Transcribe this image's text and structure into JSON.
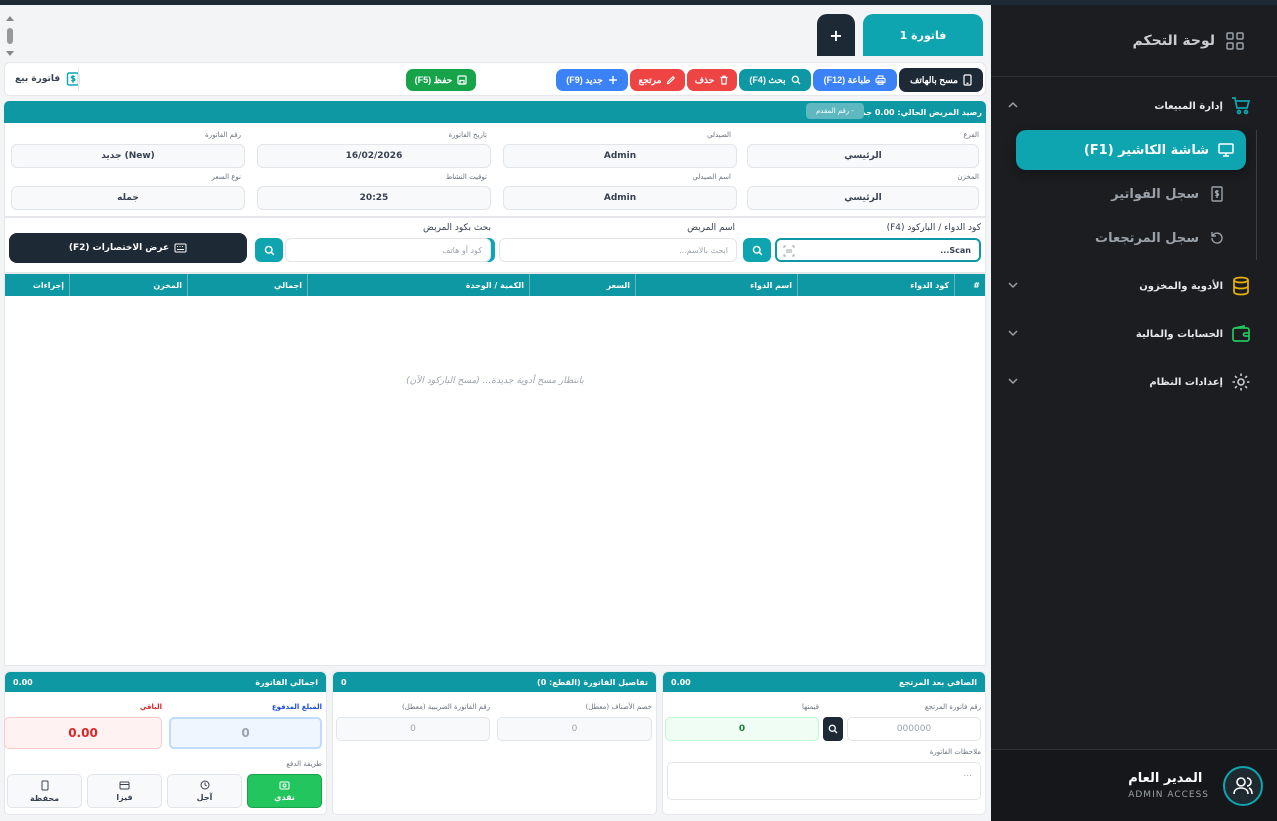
{
  "sidebar": {
    "dashboard": "لوحة التحكم",
    "sales_section": "إدارة المبيعات",
    "cashier": "شاشة الكاشير (F1)",
    "invoices_log": "سجل الفواتير",
    "returns_log": "سجل المرتجعات",
    "medicines_section": "الأدوية والمخزون",
    "accounts_section": "الحسابات والمالية",
    "settings_section": "إعدادات النظام",
    "user_name": "المدير العام",
    "user_role": "ADMIN ACCESS"
  },
  "tabs": {
    "invoice_tab": "فاتورة 1",
    "add": "+"
  },
  "toolbar": {
    "sale_invoice": "فاتورة بيع",
    "scan_mobile": "مسح بالهاتف",
    "print": "طباعة (F12)",
    "search": "بحث (F4)",
    "delete": "حذف",
    "return": "مرتجع",
    "new": "جديد (F9)",
    "save": "حفظ (F5)"
  },
  "balance": {
    "label": "رصيد المريض الحالي:",
    "value": "0.00 جم",
    "pill": "رقم المقدم -"
  },
  "info": {
    "branch_label": "الفرع",
    "branch": "الرئيسي",
    "pharmacist_label": "الصيدلي",
    "pharmacist": "Admin",
    "date_label": "تاريخ الفاتورة",
    "date": "16/02/2026",
    "invoice_no_label": "رقم الفاتورة",
    "invoice_no": "جديد (New)",
    "store_label": "المخزن",
    "store": "الرئيسي",
    "pharmacist_name_label": "اسم الصيدلي",
    "pharmacist_name": "Admin",
    "time_label": "توقيت النشاط",
    "time": "20:25",
    "price_type_label": "نوع السعر",
    "price_type": "جمله"
  },
  "search": {
    "barcode_label": "كود الدواء / الباركود (F4)",
    "barcode_placeholder": "Scan...",
    "patient_label": "اسم المريض",
    "patient_placeholder": "ابحث بالاسم...",
    "patient_code_label": "بحث بكود المريض",
    "patient_code_placeholder": "كود أو هاتف",
    "shortcuts": "عرض الاختصارات (F2)"
  },
  "grid": {
    "columns": [
      "#",
      "كود الدواء",
      "اسم الدواء",
      "السعر",
      "الكمية / الوحدة",
      "اجمالي",
      "المخزن",
      "إجراءات"
    ],
    "empty": "بانتظار مسح أدوية جديدة... (مسح الباركود الآن)"
  },
  "net_panel": {
    "title": "الصافي بعد المرتجع",
    "value": "0.00",
    "return_no_label": "رقم فاتورة المرتجع",
    "return_no_placeholder": "000000",
    "return_value_label": "قيمتها",
    "return_value": "0",
    "notes_label": "ملاحظات الفاتورة",
    "notes_placeholder": "..."
  },
  "details_panel": {
    "title": "تفاصيل الفاتورة (القطع: 0)",
    "value": "0",
    "discount_label": "خصم الأصناف (معطل)",
    "discount": "0",
    "tax_label": "رقم الفاتورة الضريبية (معطل)",
    "tax": "0"
  },
  "total_panel": {
    "title": "اجمالي الفاتورة",
    "value": "0.00",
    "paid_label": "المبلغ المدفوع",
    "paid": "0",
    "remaining_label": "الباقي",
    "remaining": "0.00",
    "payment_label": "طريقة الدفع",
    "cash": "نقدي",
    "credit": "آجل",
    "instant": "فيزا",
    "wallet": "محفظة"
  },
  "colors": {
    "accent": "#0ea5b0",
    "sidebar": "#1b1d21",
    "save": "#16a34a",
    "delete": "#ef4444",
    "new": "#3b82f6"
  }
}
